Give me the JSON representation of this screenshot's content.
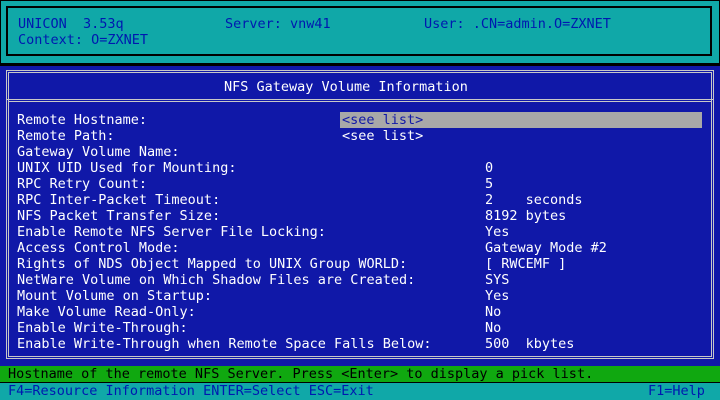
{
  "header": {
    "app": "UNICON  3.53q",
    "server": "Server: vnw41",
    "user": "User: .CN=admin.O=ZXNET",
    "context": "Context: O=ZXNET"
  },
  "dialog": {
    "title": "NFS Gateway Volume Information",
    "fields": [
      {
        "label": "Remote Hostname:",
        "value": "<see list>"
      },
      {
        "label": "Remote Path:",
        "value": "<see list>"
      },
      {
        "label": "Gateway Volume Name:",
        "value": ""
      },
      {
        "label": "UNIX UID Used for Mounting:",
        "value": "0"
      },
      {
        "label": "RPC Retry Count:",
        "value": "5"
      },
      {
        "label": "RPC Inter-Packet Timeout:",
        "value": "2    seconds"
      },
      {
        "label": "NFS Packet Transfer Size:",
        "value": "8192 bytes"
      },
      {
        "label": "Enable Remote NFS Server File Locking:",
        "value": "Yes"
      },
      {
        "label": "Access Control Mode:",
        "value": "Gateway Mode #2"
      },
      {
        "label": "Rights of NDS Object Mapped to UNIX Group WORLD:",
        "value": "[ RWCEMF ]"
      },
      {
        "label": "NetWare Volume on Which Shadow Files are Created:",
        "value": "SYS"
      },
      {
        "label": "Mount Volume on Startup:",
        "value": "Yes"
      },
      {
        "label": "Make Volume Read-Only:",
        "value": "No"
      },
      {
        "label": "Enable Write-Through:",
        "value": "No"
      },
      {
        "label": "Enable Write-Through when Remote Space Falls Below:",
        "value": "500  kbytes"
      }
    ]
  },
  "status_line": "Hostname of the remote NFS Server. Press <Enter> to display a pick list.",
  "function_keys": {
    "left": "F4=Resource Information ENTER=Select ESC=Exit",
    "right": "F1=Help"
  },
  "colors": {
    "panel": "#1018a8",
    "header": "#10a8a8",
    "status": "#10a810",
    "highlight": "#a8a8a8"
  }
}
